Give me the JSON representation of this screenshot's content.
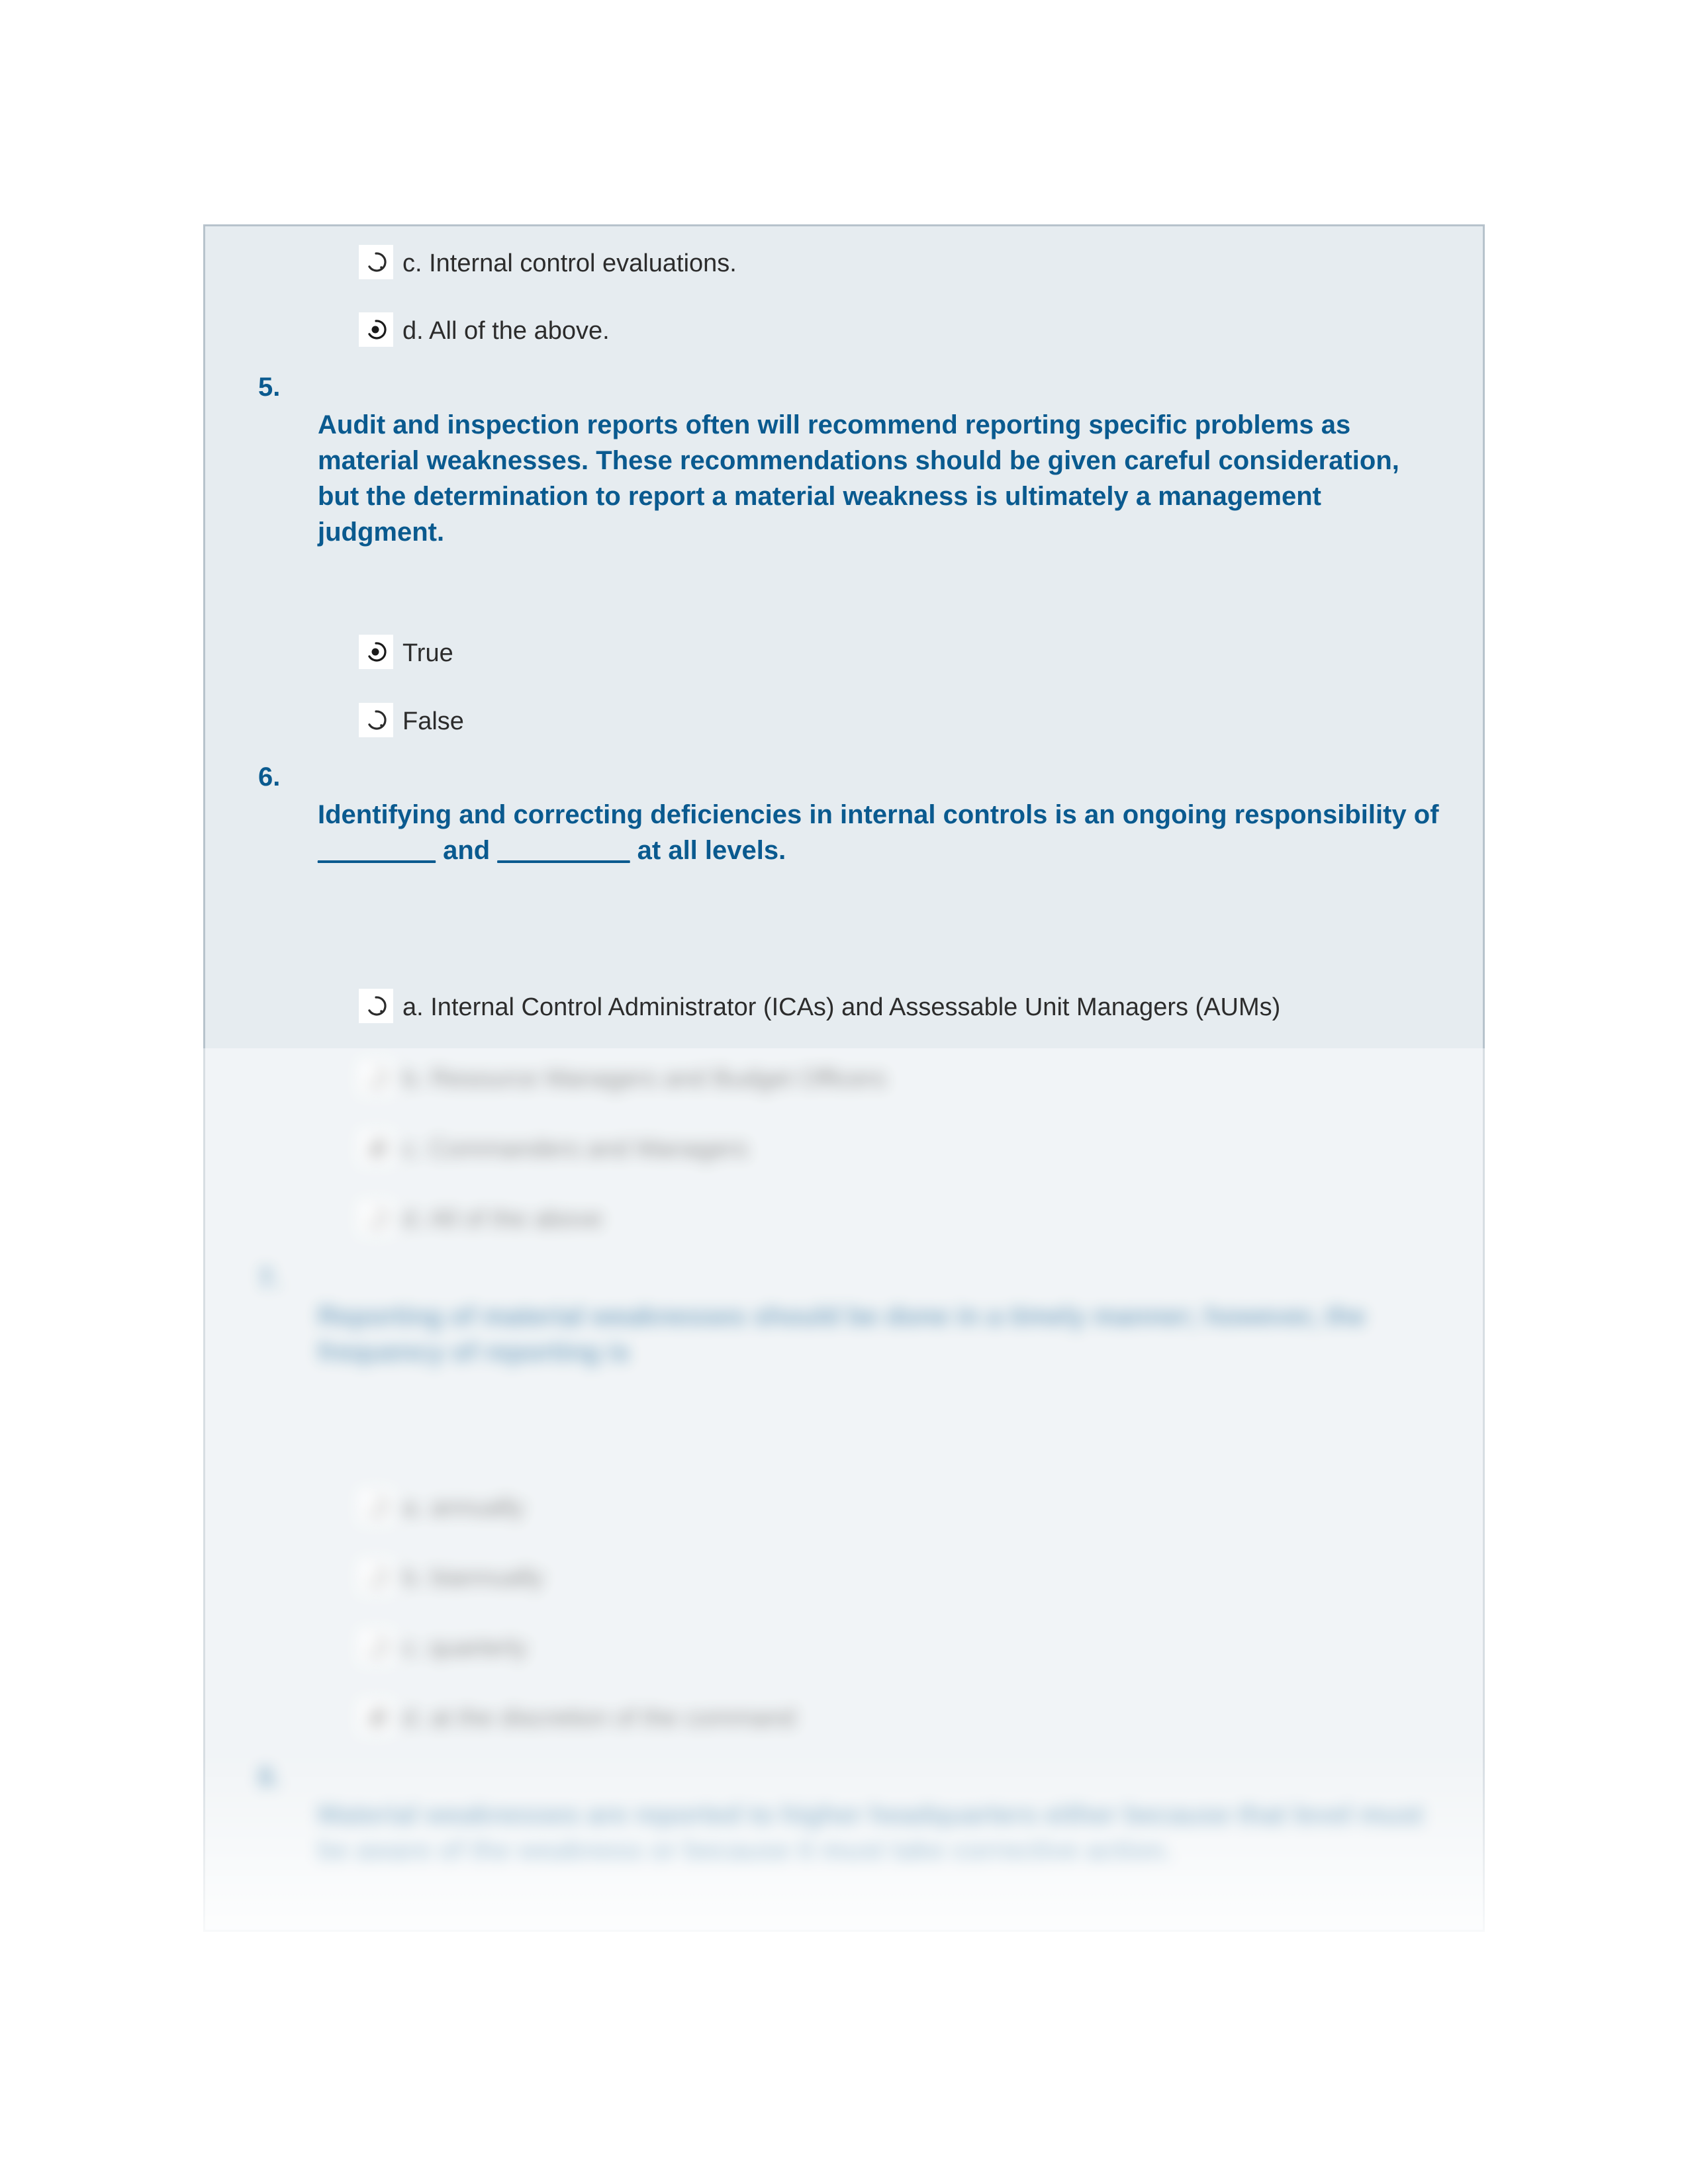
{
  "partial_options": {
    "c": "c. Internal control evaluations.",
    "d": "d. All of the above."
  },
  "q5": {
    "num": "5.",
    "text": "Audit and inspection reports often will recommend reporting specific problems as material weaknesses. These recommendations should be given careful consideration, but the determination to report a material weakness is ultimately a management judgment.",
    "opt_true": "True",
    "opt_false": "False"
  },
  "q6": {
    "num": "6.",
    "text_before": "Identifying and correcting deficiencies in internal controls is an ongoing responsibility of ",
    "blank1": "________",
    "mid": " and ",
    "blank2": "_________",
    "text_after": " at all levels.",
    "opt_a": "a. Internal Control Administrator (ICAs) and Assessable Unit Managers (AUMs)",
    "opt_b": "b. Resource Managers and Budget Officers",
    "opt_c": "c. Commanders and Managers",
    "opt_d": "d. All of the above"
  },
  "q7": {
    "num": "7.",
    "text": "Reporting of material weaknesses should be done in a timely manner; however, the frequency of reporting is",
    "opt_a": "a. annually",
    "opt_b": "b. biannually",
    "opt_c": "c. quarterly",
    "opt_d": "d. at the discretion of the command"
  },
  "q8": {
    "num": "8.",
    "text": "Material weaknesses are reported to higher headquarters either because that level must be aware of the weakness or because it must take corrective action."
  }
}
